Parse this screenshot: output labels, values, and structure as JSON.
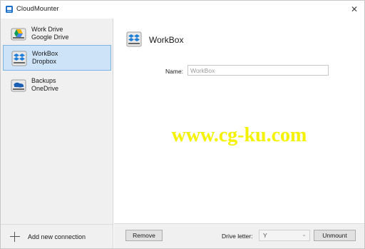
{
  "window": {
    "title": "CloudMounter"
  },
  "sidebar": {
    "connections": [
      {
        "name": "Work Drive",
        "service": "Google Drive",
        "icon": "google-drive-icon",
        "selected": false
      },
      {
        "name": "WorkBox",
        "service": "Dropbox",
        "icon": "dropbox-icon",
        "selected": true
      },
      {
        "name": "Backups",
        "service": "OneDrive",
        "icon": "onedrive-icon",
        "selected": false
      }
    ],
    "add_label": "Add new connection"
  },
  "main": {
    "title": "WorkBox",
    "header_icon": "dropbox-icon",
    "name_label": "Name:",
    "name_value": "WorkBox"
  },
  "watermark": "www.cg-ku.com",
  "bottom": {
    "remove_label": "Remove",
    "drive_letter_label": "Drive letter:",
    "drive_letter_value": "Y",
    "unmount_label": "Unmount"
  },
  "colors": {
    "selection_bg": "#cde3f7",
    "selection_border": "#7fb3e2",
    "dropbox_blue": "#1f7fd6",
    "onedrive_blue": "#1a5fb4",
    "watermark_yellow": "#f5f200"
  }
}
